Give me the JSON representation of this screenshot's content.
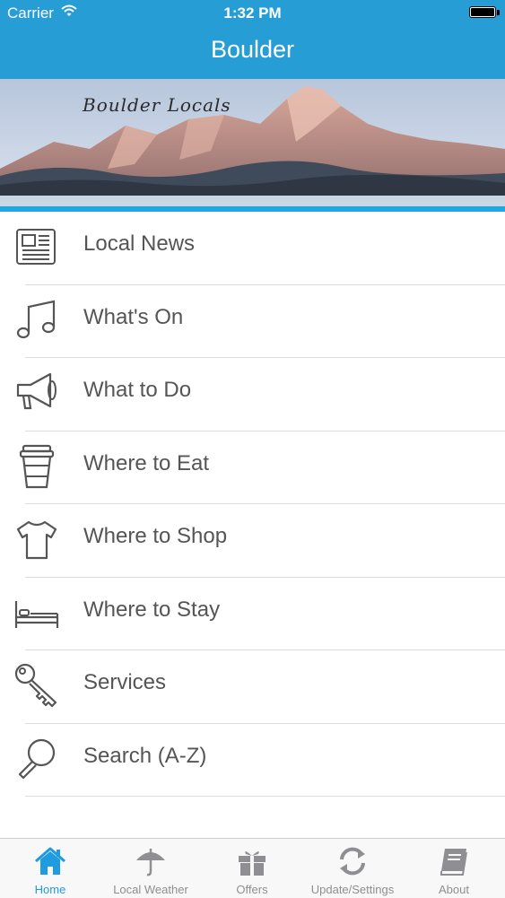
{
  "status_bar": {
    "carrier": "Carrier",
    "time": "1:32 PM"
  },
  "nav": {
    "title": "Boulder"
  },
  "banner": {
    "text": "Boulder Locals"
  },
  "menu": [
    {
      "label": "Local News",
      "icon": "newspaper-icon"
    },
    {
      "label": "What's On",
      "icon": "music-note-icon"
    },
    {
      "label": "What to Do",
      "icon": "megaphone-icon"
    },
    {
      "label": "Where to Eat",
      "icon": "coffee-cup-icon"
    },
    {
      "label": "Where to Shop",
      "icon": "tshirt-icon"
    },
    {
      "label": "Where to Stay",
      "icon": "bed-icon"
    },
    {
      "label": "Services",
      "icon": "key-icon"
    },
    {
      "label": "Search (A-Z)",
      "icon": "magnifier-icon"
    }
  ],
  "tabs": [
    {
      "label": "Home",
      "icon": "home-icon",
      "active": true
    },
    {
      "label": "Local Weather",
      "icon": "umbrella-icon",
      "active": false
    },
    {
      "label": "Offers",
      "icon": "gift-icon",
      "active": false
    },
    {
      "label": "Update/Settings",
      "icon": "refresh-icon",
      "active": false
    },
    {
      "label": "About",
      "icon": "book-icon",
      "active": false
    }
  ],
  "colors": {
    "brand": "#279dd6",
    "active_tab": "#1f9be0",
    "inactive_tab": "#8e8e93",
    "label": "#555555"
  }
}
